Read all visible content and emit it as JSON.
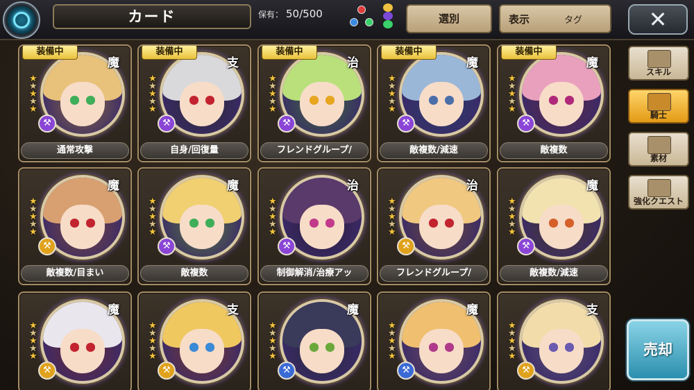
{
  "header": {
    "title": "カード",
    "holding_label": "保有：",
    "holding_count": "50/500",
    "select_label": "選別",
    "display_label": "表示",
    "display_value": "タグ",
    "close_label": "✕"
  },
  "side_menu": [
    {
      "label": "スキル",
      "active": false
    },
    {
      "label": "騎士",
      "active": true
    },
    {
      "label": "素材",
      "active": false
    },
    {
      "label": "強化クエスト",
      "active": false
    }
  ],
  "sell_label": "売却",
  "cards": [
    {
      "equipped": true,
      "type": "魔",
      "skill": "通常攻撃",
      "hair": "#e8c27a",
      "eye": "#3fae5a",
      "bg": "#8a6a40",
      "weapon": "#8a45d6"
    },
    {
      "equipped": true,
      "type": "支",
      "skill": "自身/回復量",
      "hair": "#d9d9dc",
      "eye": "#c2242f",
      "bg": "#2b2b30",
      "weapon": "#8a45d6"
    },
    {
      "equipped": true,
      "type": "治",
      "skill": "フレンドグループ/",
      "hair": "#b9e07a",
      "eye": "#e7a520",
      "bg": "#3e6a3a",
      "weapon": "#8a45d6"
    },
    {
      "equipped": true,
      "type": "魔",
      "skill": "敵複数/減速",
      "hair": "#9ab7d8",
      "eye": "#4a6ea8",
      "bg": "#2c3c66",
      "weapon": "#8a45d6"
    },
    {
      "equipped": true,
      "type": "魔",
      "skill": "敵複数",
      "hair": "#e9a0bd",
      "eye": "#b0287a",
      "bg": "#5a2a44",
      "weapon": "#8a45d6"
    },
    {
      "equipped": false,
      "type": "魔",
      "skill": "敵複数/目まい",
      "hair": "#d8a070",
      "eye": "#c2242f",
      "bg": "#7a4a3a",
      "weapon": "#e0a21c"
    },
    {
      "equipped": false,
      "type": "魔",
      "skill": "敵複数",
      "hair": "#f0d070",
      "eye": "#3fae5a",
      "bg": "#5a7a3a",
      "weapon": "#8a45d6"
    },
    {
      "equipped": false,
      "type": "治",
      "skill": "制御解消/治療アッ",
      "hair": "#5a3a6a",
      "eye": "#c23a8a",
      "bg": "#2a1e36",
      "weapon": "#8a45d6"
    },
    {
      "equipped": false,
      "type": "治",
      "skill": "フレンドグループ/",
      "hair": "#f0c880",
      "eye": "#c2242f",
      "bg": "#6a4a34",
      "weapon": "#e0a21c"
    },
    {
      "equipped": false,
      "type": "魔",
      "skill": "敵複数/減速",
      "hair": "#f2e2b0",
      "eye": "#d6602a",
      "bg": "#4a3a2a",
      "weapon": "#8a45d6"
    },
    {
      "equipped": false,
      "type": "魔",
      "skill": "",
      "hair": "#e9e6ee",
      "eye": "#c2242f",
      "bg": "#6a2a34",
      "weapon": "#e0a21c"
    },
    {
      "equipped": false,
      "type": "支",
      "skill": "",
      "hair": "#f0c860",
      "eye": "#3a8ad6",
      "bg": "#7a3a2a",
      "weapon": "#e0a21c"
    },
    {
      "equipped": false,
      "type": "魔",
      "skill": "",
      "hair": "#3a3a5a",
      "eye": "#6aa83a",
      "bg": "#2a2a3a",
      "weapon": "#3a6ad6"
    },
    {
      "equipped": false,
      "type": "魔",
      "skill": "",
      "hair": "#f0c070",
      "eye": "#b03a8a",
      "bg": "#6a4a5a",
      "weapon": "#3a6ad6"
    },
    {
      "equipped": false,
      "type": "支",
      "skill": "",
      "hair": "#f2dcaa",
      "eye": "#6a5ab0",
      "bg": "#5a5070",
      "weapon": "#e0a21c"
    }
  ],
  "equipped_label": "装備中",
  "star_glyph": "★"
}
